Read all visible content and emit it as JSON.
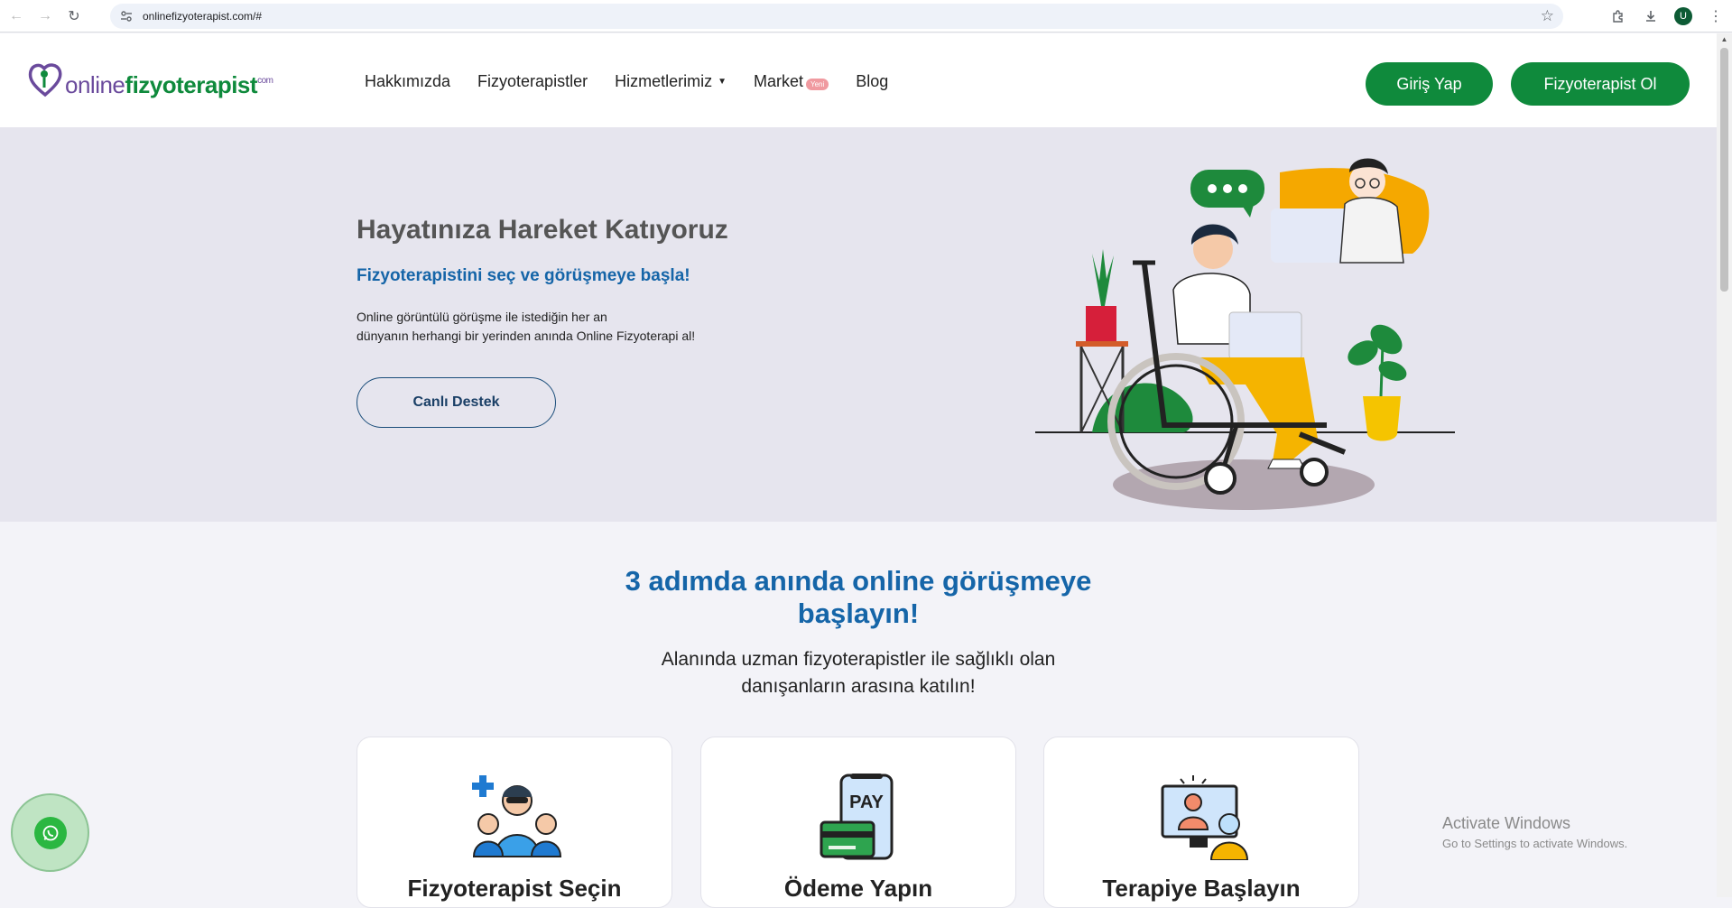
{
  "browser": {
    "url": "onlinefizyoterapist.com/#",
    "profile_initial": "U"
  },
  "logo": {
    "part1": "online",
    "part2": "fizyoterapist",
    "suffix": "com"
  },
  "nav": {
    "items": [
      "Hakkımızda",
      "Fizyoterapistler",
      "Hizmetlerimiz",
      "Market",
      "Blog"
    ],
    "market_badge": "Yeni",
    "login": "Giriş Yap",
    "become": "Fizyoterapist Ol"
  },
  "hero": {
    "title": "Hayatınıza Hareket Katıyoruz",
    "subtitle": "Fizyoterapistini seç ve görüşmeye başla!",
    "desc_line1": "Online görüntülü görüşme ile istediğin her an",
    "desc_line2": "dünyanın herhangi bir yerinden anında Online Fizyoterapi al!",
    "button": "Canlı Destek"
  },
  "steps": {
    "title_line1": "3 adımda anında online görüşmeye",
    "title_line2": "başlayın!",
    "sub_line1": "Alanında uzman fizyoterapistler ile sağlıklı olan",
    "sub_line2": "danışanların arasına katılın!",
    "cards": [
      {
        "title": "Fizyoterapist Seçin"
      },
      {
        "title": "Ödeme Yapın",
        "icon_text": "PAY"
      },
      {
        "title": "Terapiye Başlayın"
      }
    ]
  },
  "watermark": {
    "line1": "Activate Windows",
    "line2": "Go to Settings to activate Windows."
  },
  "colors": {
    "brand_green": "#0f8a3c",
    "brand_blue": "#1565a8",
    "brand_purple": "#6a4a9c",
    "hero_bg": "#e6e5ee"
  }
}
